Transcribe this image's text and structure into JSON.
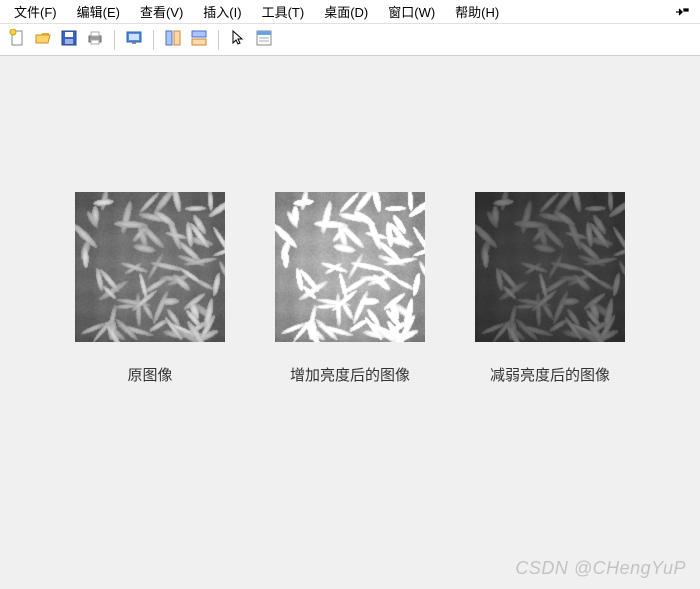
{
  "menu": {
    "file": "文件(F)",
    "edit": "编辑(E)",
    "view": "查看(V)",
    "insert": "插入(I)",
    "tools": "工具(T)",
    "desktop": "桌面(D)",
    "window": "窗口(W)",
    "help": "帮助(H)"
  },
  "toolbar_icons": {
    "new": "new-file-icon",
    "open": "open-folder-icon",
    "save": "save-icon",
    "print": "print-icon",
    "screen": "screen-icon",
    "tile_h": "tile-horizontal-icon",
    "tile_v": "tile-vertical-icon",
    "pointer": "pointer-icon",
    "properties": "properties-icon"
  },
  "figures": [
    {
      "key": "original",
      "caption": "原图像",
      "brightness": 1.0
    },
    {
      "key": "brighter",
      "caption": "增加亮度后的图像",
      "brightness": 1.5
    },
    {
      "key": "darker",
      "caption": "减弱亮度后的图像",
      "brightness": 0.55
    }
  ],
  "watermark": "CSDN @CHengYuP"
}
